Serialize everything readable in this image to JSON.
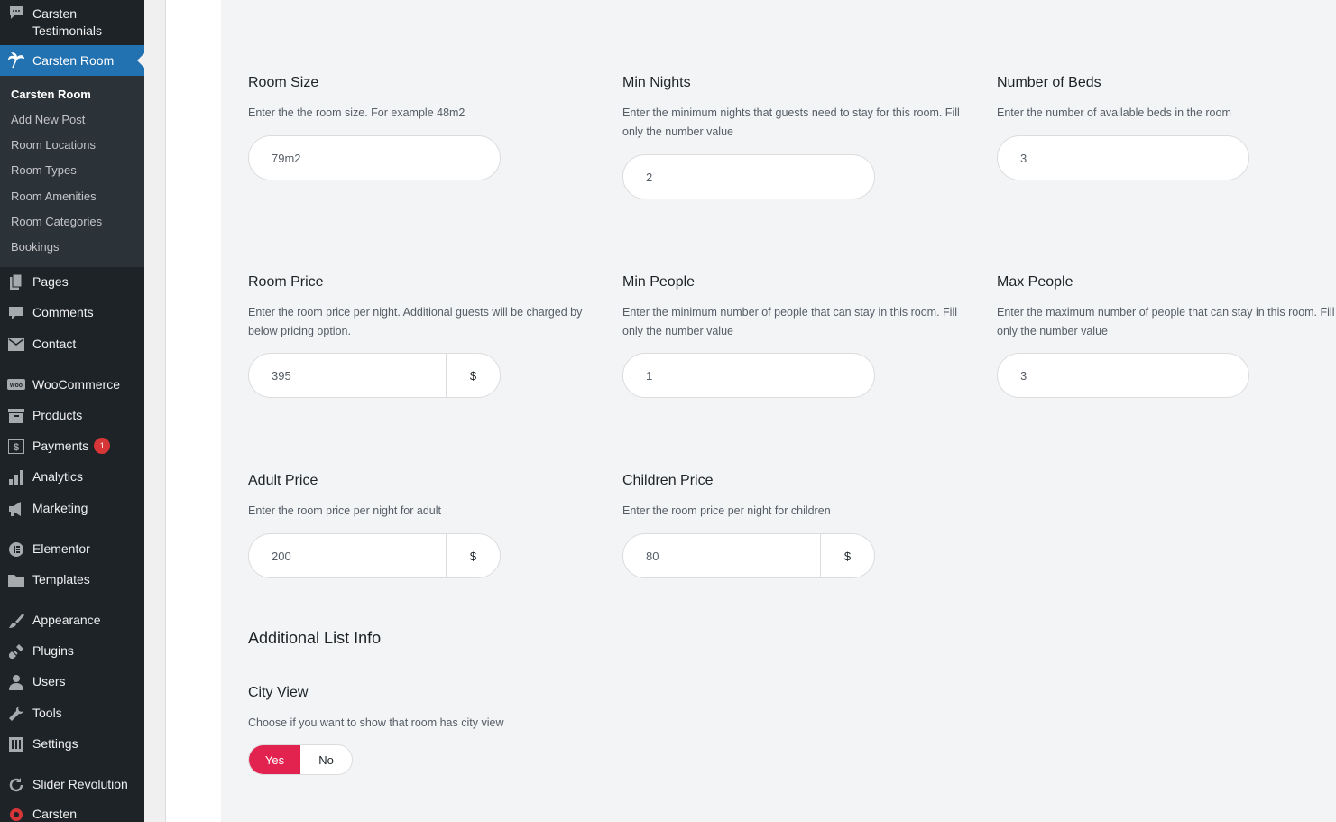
{
  "sidebar": {
    "top_item": {
      "label_line1": "Carsten",
      "label_line2": "Testimonials",
      "icon": "speech-bubble-icon"
    },
    "active_item": {
      "label": "Carsten Room",
      "icon": "palm-tree-icon"
    },
    "submenu": [
      "Carsten Room",
      "Add New Post",
      "Room Locations",
      "Room Types",
      "Room Amenities",
      "Room Categories",
      "Bookings"
    ],
    "items": [
      {
        "label": "Pages",
        "icon": "pages-icon"
      },
      {
        "label": "Comments",
        "icon": "comments-icon"
      },
      {
        "label": "Contact",
        "icon": "mail-icon"
      },
      {
        "label": "WooCommerce",
        "icon": "woo-icon"
      },
      {
        "label": "Products",
        "icon": "archive-icon"
      },
      {
        "label": "Payments",
        "icon": "dollar-icon",
        "badge": "1"
      },
      {
        "label": "Analytics",
        "icon": "bar-chart-icon"
      },
      {
        "label": "Marketing",
        "icon": "megaphone-icon"
      },
      {
        "label": "Elementor",
        "icon": "elementor-icon"
      },
      {
        "label": "Templates",
        "icon": "folder-icon"
      },
      {
        "label": "Appearance",
        "icon": "brush-icon"
      },
      {
        "label": "Plugins",
        "icon": "plug-icon"
      },
      {
        "label": "Users",
        "icon": "user-icon"
      },
      {
        "label": "Tools",
        "icon": "wrench-icon"
      },
      {
        "label": "Settings",
        "icon": "settings-icon"
      },
      {
        "label": "Slider Revolution",
        "icon": "refresh-icon"
      },
      {
        "label": "Carsten",
        "icon": "circle-icon"
      }
    ]
  },
  "fields": {
    "room_size": {
      "title": "Room Size",
      "desc": "Enter the the room size. For example 48m2",
      "value": "79m2"
    },
    "min_nights": {
      "title": "Min Nights",
      "desc": "Enter the minimum nights that guests need to stay for this room. Fill only the number value",
      "value": "2"
    },
    "number_of_beds": {
      "title": "Number of Beds",
      "desc": "Enter the number of available beds in the room",
      "value": "3"
    },
    "room_price": {
      "title": "Room Price",
      "desc": "Enter the room price per night. Additional guests will be charged by below pricing option.",
      "value": "395",
      "unit": "$"
    },
    "min_people": {
      "title": "Min People",
      "desc": "Enter the minimum number of people that can stay in this room. Fill only the number value",
      "value": "1"
    },
    "max_people": {
      "title": "Max People",
      "desc": "Enter the maximum number of people that can stay in this room. Fill only the number value",
      "value": "3"
    },
    "adult_price": {
      "title": "Adult Price",
      "desc": "Enter the room price per night for adult",
      "value": "200",
      "unit": "$"
    },
    "children_price": {
      "title": "Children Price",
      "desc": "Enter the room price per night for children",
      "value": "80",
      "unit": "$"
    }
  },
  "additional": {
    "section_title": "Additional List Info",
    "city_view": {
      "title": "City View",
      "desc": "Choose if you want to show that room has city view",
      "yes": "Yes",
      "no": "No",
      "selected": "Yes"
    }
  },
  "colors": {
    "sidebar_bg": "#1d2327",
    "active_bg": "#2271b1",
    "accent": "#e2234f",
    "badge": "#d63638"
  }
}
